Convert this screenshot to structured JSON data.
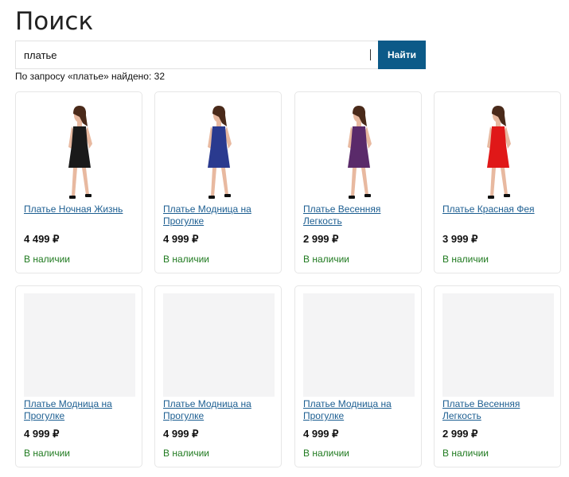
{
  "page": {
    "title": "Поиск"
  },
  "search": {
    "value": "платье",
    "button_label": "Найти"
  },
  "results": {
    "summary": "По запросу «платье» найдено: 32"
  },
  "products": [
    {
      "name": "Платье Ночная Жизнь",
      "price": "4 499 ₽",
      "stock": "В наличии",
      "dress_color": "#1a1a1a",
      "image": "model-photo"
    },
    {
      "name": "Платье Модница на Прогулке",
      "price": "4 999 ₽",
      "stock": "В наличии",
      "dress_color": "#2a3a8f",
      "image": "model-photo"
    },
    {
      "name": "Платье Весенняя Легкость",
      "price": "2 999 ₽",
      "stock": "В наличии",
      "dress_color": "#5a2a6a",
      "image": "model-photo"
    },
    {
      "name": "Платье Красная Фея",
      "price": "3 999 ₽",
      "stock": "В наличии",
      "dress_color": "#e01818",
      "image": "model-photo"
    },
    {
      "name": "Платье Модница на Прогулке",
      "price": "4 999 ₽",
      "stock": "В наличии",
      "image": "placeholder"
    },
    {
      "name": "Платье Модница на Прогулке",
      "price": "4 999 ₽",
      "stock": "В наличии",
      "image": "placeholder"
    },
    {
      "name": "Платье Модница на Прогулке",
      "price": "4 999 ₽",
      "stock": "В наличии",
      "image": "placeholder"
    },
    {
      "name": "Платье Весенняя Легкость",
      "price": "2 999 ₽",
      "stock": "В наличии",
      "image": "placeholder"
    }
  ],
  "colors": {
    "accent": "#0c5a88",
    "link": "#1c5e91",
    "in_stock": "#1f7a1f",
    "placeholder": "#f4f4f5"
  }
}
